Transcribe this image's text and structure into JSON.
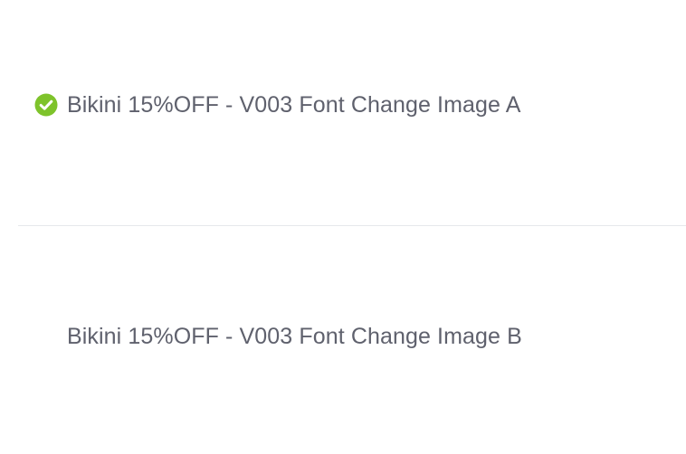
{
  "variants": [
    {
      "label": "Bikini 15%OFF - V003 Font Change Image A",
      "selected": true,
      "icon": "check-circle-icon",
      "icon_color": "#7ec32b"
    },
    {
      "label": "Bikini 15%OFF - V003 Font Change Image B",
      "selected": false
    }
  ],
  "colors": {
    "text": "#5f616d",
    "divider": "#e6e8eb",
    "background": "#ffffff"
  }
}
